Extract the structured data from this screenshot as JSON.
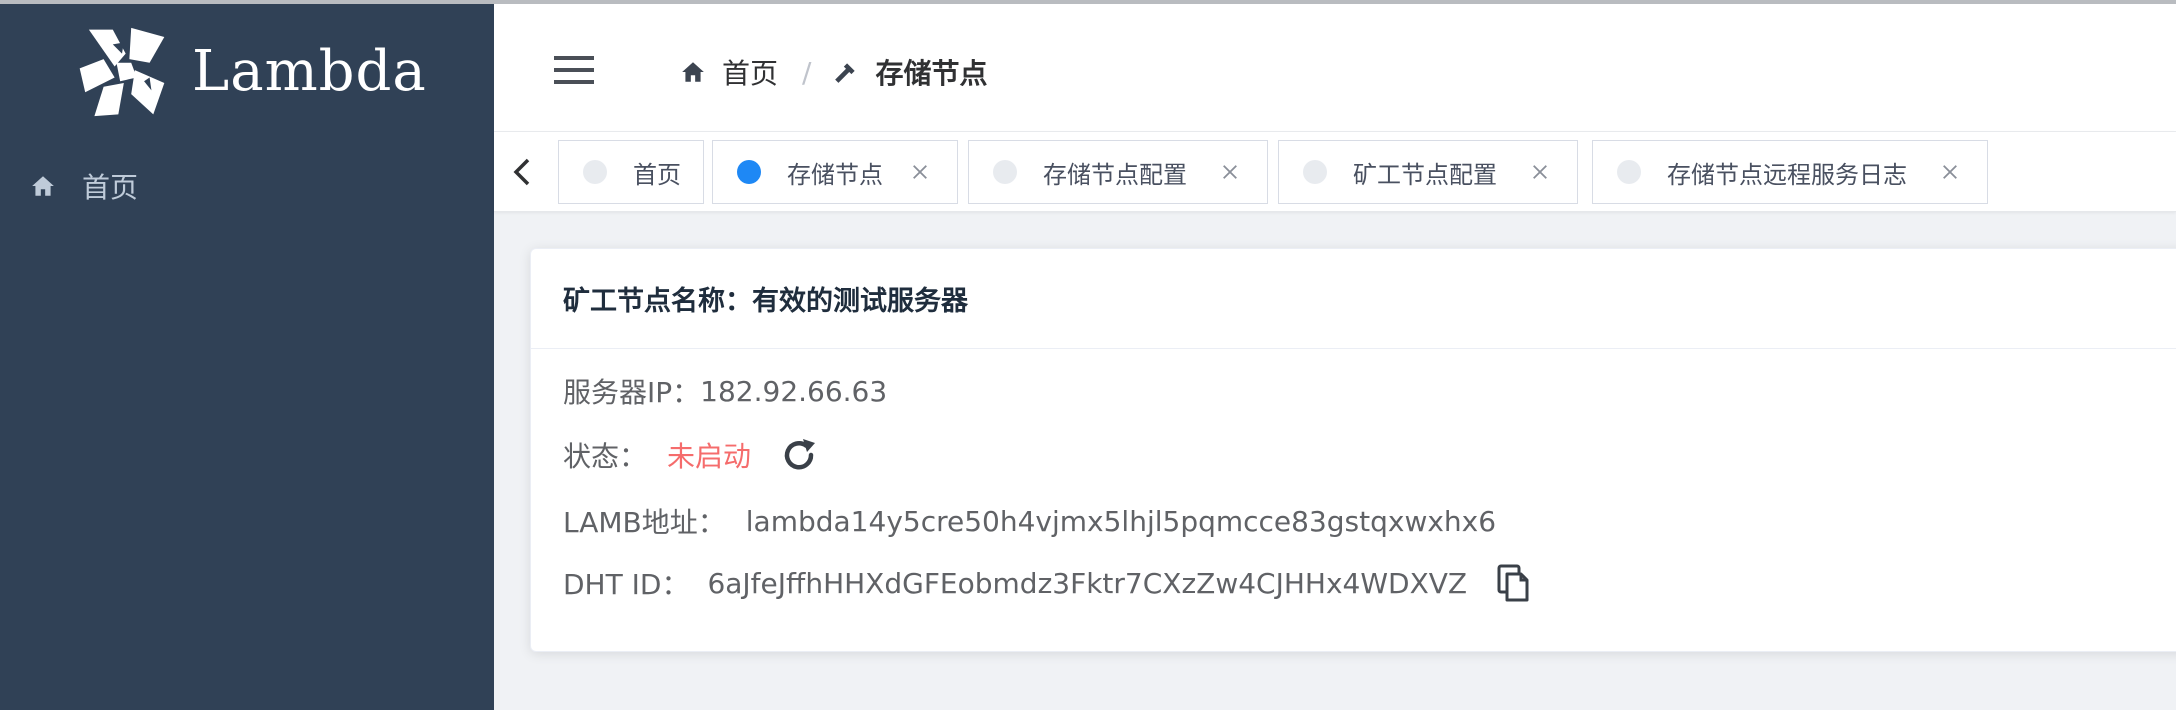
{
  "brand": {
    "name": "Lambda"
  },
  "sidebar": {
    "items": [
      {
        "label": "首页",
        "icon": "home-icon"
      }
    ]
  },
  "header": {
    "breadcrumb": [
      {
        "label": "首页",
        "icon": "home-icon"
      },
      {
        "label": "存储节点",
        "icon": "hammer-icon"
      }
    ],
    "separator": "/"
  },
  "tags": [
    {
      "label": "首页",
      "active": false,
      "closable": false
    },
    {
      "label": "存储节点",
      "active": true,
      "closable": true
    },
    {
      "label": "存储节点配置",
      "active": false,
      "closable": true
    },
    {
      "label": "矿工节点配置",
      "active": false,
      "closable": true
    },
    {
      "label": "存储节点远程服务日志",
      "active": false,
      "closable": true
    }
  ],
  "card": {
    "title": "矿工节点名称：有效的测试服务器",
    "server_ip_label": "服务器IP：",
    "server_ip_value": "182.92.66.63",
    "status_label": "状态：",
    "status_value": "未启动",
    "lamb_label": "LAMB地址：",
    "lamb_value": "lambda14y5cre50h4vjmx5lhjl5pqmcce83gstqxwxhx6",
    "dht_label": "DHT ID：",
    "dht_value": "6aJfeJffhHHXdGFEobmdz3Fktr7CXzZw4CJHHx4WDXVZ"
  },
  "colors": {
    "sidebar_bg": "#304156",
    "active_dot": "#1e88f5",
    "status_red": "#f56c6c"
  }
}
